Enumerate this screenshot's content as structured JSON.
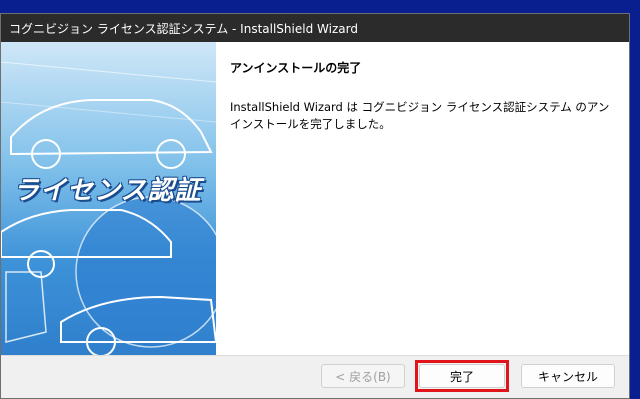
{
  "window": {
    "title": "コグニビジョン ライセンス認証システム - InstallShield Wizard"
  },
  "left_panel": {
    "brand_text": "ライセンス認証"
  },
  "content": {
    "heading": "アンインストールの完了",
    "message": "InstallShield Wizard は コグニビジョン ライセンス認証システム のアンインストールを完了しました。"
  },
  "buttons": {
    "back_label": "< 戻る(B)",
    "finish_label": "完了",
    "cancel_label": "キャンセル"
  },
  "colors": {
    "highlight": "#e0151b",
    "desktop": "#0a1f8f"
  }
}
